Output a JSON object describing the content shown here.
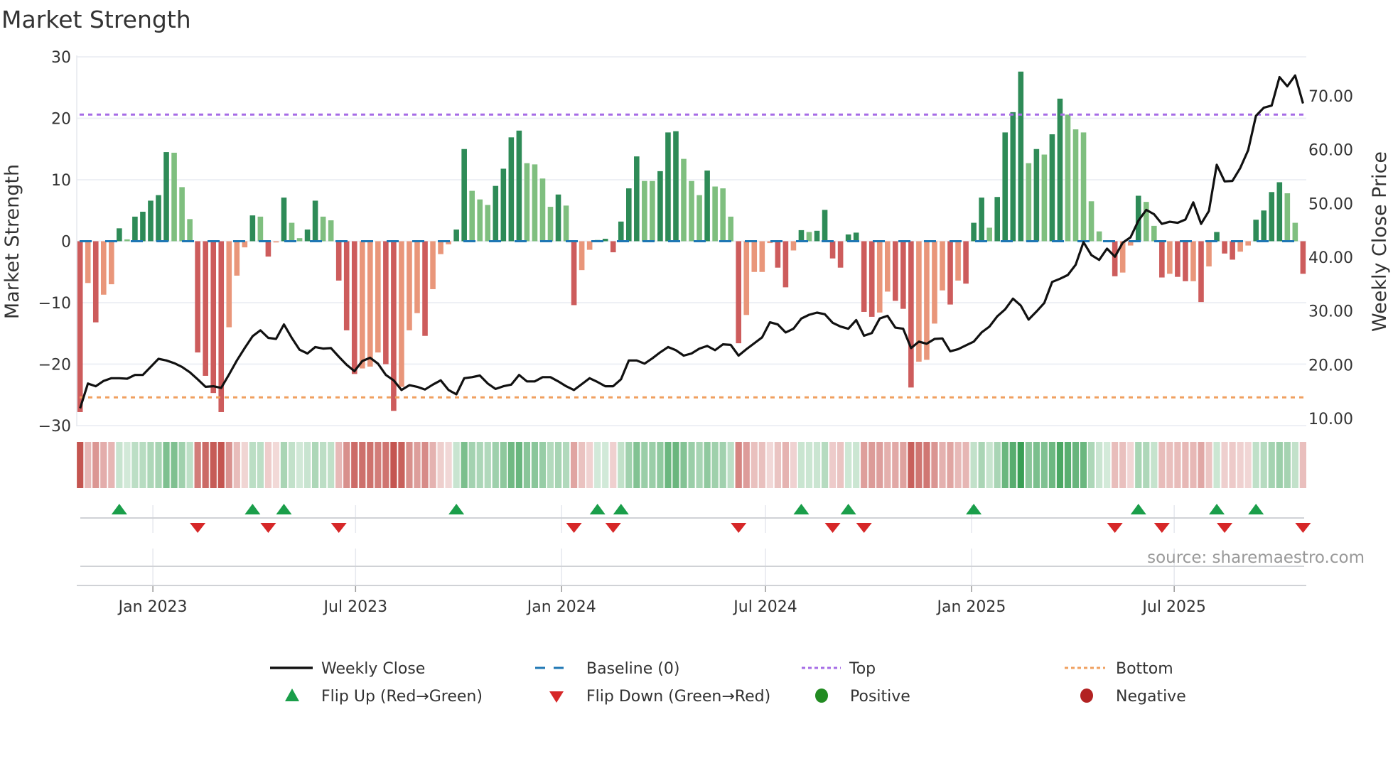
{
  "chart_data": {
    "type": "bar",
    "title": "Market Strength",
    "ylabel": "Market Strength",
    "y2label": "Weekly Close Price",
    "ylim": [
      -30,
      30
    ],
    "y2lim": [
      10,
      70
    ],
    "start_date": "2022-10-28",
    "frequency": "weekly",
    "y_ticks_left": [
      "30",
      "20",
      "10",
      "0",
      "−10",
      "−20",
      "−30"
    ],
    "y_tick_values_left": [
      30,
      20,
      10,
      0,
      -10,
      -20,
      -30
    ],
    "y_ticks_right": [
      "70.00",
      "60.00",
      "50.00",
      "40.00",
      "30.00",
      "20.00",
      "10.00"
    ],
    "y_tick_values_right": [
      70,
      60,
      50,
      40,
      30,
      20,
      10
    ],
    "x_ticks": [
      {
        "label": "Jan 2023",
        "date": "2023-01-01"
      },
      {
        "label": "Jul 2023",
        "date": "2023-07-01"
      },
      {
        "label": "Jan 2024",
        "date": "2024-01-01"
      },
      {
        "label": "Jul 2024",
        "date": "2024-07-01"
      },
      {
        "label": "Jan 2025",
        "date": "2025-01-01"
      },
      {
        "label": "Jul 2025",
        "date": "2025-07-01"
      }
    ],
    "top_level": 20.6,
    "bottom_level": -25.4,
    "baseline": 0,
    "strength": [
      -27.8,
      -6.8,
      -13.2,
      -8.7,
      -7.0,
      2.1,
      0.3,
      4.0,
      4.8,
      6.6,
      7.5,
      14.5,
      14.4,
      8.8,
      3.6,
      -18.1,
      -21.9,
      -24.7,
      -27.8,
      -14.0,
      -5.6,
      -1.0,
      4.2,
      4.0,
      -2.5,
      -0.2,
      7.1,
      3.0,
      0.5,
      1.9,
      6.6,
      4.0,
      3.4,
      -6.4,
      -14.5,
      -21.6,
      -20.7,
      -20.4,
      -18.1,
      -20.0,
      -27.6,
      -23.7,
      -14.5,
      -11.7,
      -15.4,
      -7.8,
      -2.1,
      -0.5,
      1.9,
      15.0,
      8.2,
      6.8,
      5.9,
      9.0,
      11.8,
      16.9,
      18.0,
      12.7,
      12.5,
      10.2,
      5.6,
      7.6,
      5.8,
      -10.4,
      -4.7,
      -1.4,
      0.2,
      0.4,
      -1.8,
      3.2,
      8.6,
      13.8,
      9.8,
      9.8,
      11.4,
      17.7,
      17.9,
      13.4,
      9.8,
      7.5,
      11.5,
      8.9,
      8.6,
      4.0,
      -16.6,
      -12.0,
      -5.0,
      -5.0,
      -0.3,
      -4.3,
      -7.5,
      -1.5,
      1.8,
      1.5,
      1.7,
      5.1,
      -2.8,
      -4.3,
      1.1,
      1.4,
      -11.5,
      -12.3,
      -11.6,
      -8.2,
      -9.7,
      -11.0,
      -23.8,
      -19.6,
      -19.3,
      -13.4,
      -8.0,
      -10.3,
      -6.4,
      -6.9,
      3.0,
      7.1,
      2.2,
      7.2,
      17.7,
      21.0,
      27.6,
      12.7,
      15.0,
      14.1,
      17.4,
      23.2,
      20.6,
      18.2,
      17.7,
      6.5,
      1.6,
      0.1,
      -5.7,
      -5.1,
      -0.7,
      7.4,
      6.4,
      2.5,
      -5.9,
      -5.3,
      -5.8,
      -6.5,
      -6.5,
      -9.9,
      -4.1,
      1.5,
      -2.0,
      -3.0,
      -1.7,
      -0.7,
      3.5,
      5.0,
      8.0,
      9.6,
      7.8,
      3.0,
      -5.3
    ],
    "weekly_close": [
      11.9,
      16.5,
      16.0,
      17.0,
      17.5,
      17.5,
      17.4,
      18.1,
      18.1,
      19.6,
      21.1,
      20.8,
      20.3,
      19.6,
      18.6,
      17.3,
      15.9,
      16.0,
      15.7,
      18.2,
      20.8,
      23.1,
      25.3,
      26.4,
      25.0,
      24.8,
      27.5,
      25.0,
      22.8,
      22.1,
      23.3,
      23.0,
      23.1,
      21.5,
      20.0,
      18.8,
      20.7,
      21.3,
      20.2,
      18.1,
      17.1,
      15.3,
      16.2,
      15.9,
      15.4,
      16.3,
      17.1,
      15.3,
      14.5,
      17.5,
      17.7,
      18.0,
      16.5,
      15.5,
      16.0,
      16.3,
      18.1,
      16.9,
      16.9,
      17.7,
      17.7,
      16.9,
      16.0,
      15.3,
      16.4,
      17.5,
      16.8,
      16.0,
      16.0,
      17.3,
      20.8,
      20.8,
      20.2,
      21.2,
      22.3,
      23.3,
      22.7,
      21.7,
      22.1,
      23.0,
      23.5,
      22.7,
      23.8,
      23.7,
      21.7,
      22.9,
      24.0,
      25.1,
      27.9,
      27.5,
      26.0,
      26.7,
      28.6,
      29.3,
      29.7,
      29.4,
      27.8,
      27.1,
      26.7,
      28.3,
      25.4,
      25.9,
      28.6,
      29.1,
      26.9,
      26.7,
      23.1,
      24.3,
      23.9,
      24.8,
      24.9,
      22.5,
      22.9,
      23.6,
      24.3,
      26.0,
      27.1,
      29.0,
      30.3,
      32.3,
      31.0,
      28.4,
      29.9,
      31.5,
      35.4,
      36.0,
      36.7,
      38.6,
      42.8,
      40.4,
      39.5,
      41.6,
      40.1,
      42.7,
      43.7,
      46.8,
      48.8,
      48.0,
      46.2,
      46.6,
      46.4,
      47.0,
      50.2,
      46.2,
      48.6,
      57.2,
      54.1,
      54.2,
      56.6,
      59.9,
      66.3,
      67.8,
      68.2,
      73.5,
      71.8,
      73.8,
      68.6
    ],
    "flip_up_weeks": [
      5,
      22,
      26,
      48,
      66,
      69,
      92,
      98,
      114,
      135,
      145,
      150
    ],
    "flip_down_weeks": [
      15,
      24,
      33,
      63,
      68,
      84,
      96,
      100,
      132,
      138,
      146,
      156
    ],
    "legend_placement": "bottom",
    "legend": [
      {
        "label": "Weekly Close"
      },
      {
        "label": "Baseline (0)"
      },
      {
        "label": "Top"
      },
      {
        "label": "Bottom"
      },
      {
        "label": "Flip Up (Red→Green)"
      },
      {
        "label": "Flip Down (Green→Red)"
      },
      {
        "label": "Positive"
      },
      {
        "label": "Negative"
      }
    ],
    "colors": {
      "pos_strong": "#2e8b57",
      "pos_weak": "#7fbf7f",
      "neg_strong": "#cd5c5c",
      "neg_weak": "#e9967a",
      "line": "#111111",
      "baseline": "#1f77b4",
      "top": "#a66ce6",
      "bottom": "#f0a060",
      "flip_up": "#1a9e4a",
      "flip_down": "#d62728",
      "positive": "#228b22",
      "negative": "#b22222"
    }
  },
  "source": "source: sharemaestro.com"
}
